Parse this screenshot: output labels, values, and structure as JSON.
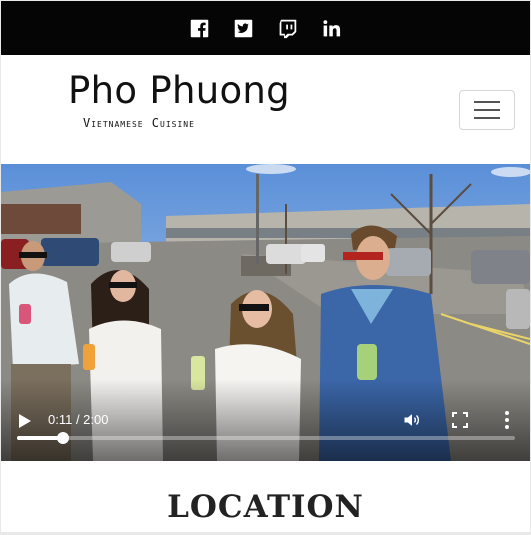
{
  "social": [
    {
      "icon": "facebook-icon"
    },
    {
      "icon": "twitter-icon"
    },
    {
      "icon": "twitch-icon"
    },
    {
      "icon": "linkedin-icon"
    }
  ],
  "brand": {
    "name": "Pho Phuong",
    "tagline": "Vietnamese Cuisine"
  },
  "navbar": {
    "toggle_icon": "hamburger-icon"
  },
  "video": {
    "time": "0:11 / 2:00",
    "progress": 0.092,
    "controls": [
      "play-icon",
      "volume-icon",
      "fullscreen-icon",
      "more-options-icon"
    ]
  },
  "section": {
    "title": "LOCATION"
  },
  "colors": {
    "social_bar": "#050505",
    "page_bg": "#ffffff",
    "text": "#111111"
  }
}
